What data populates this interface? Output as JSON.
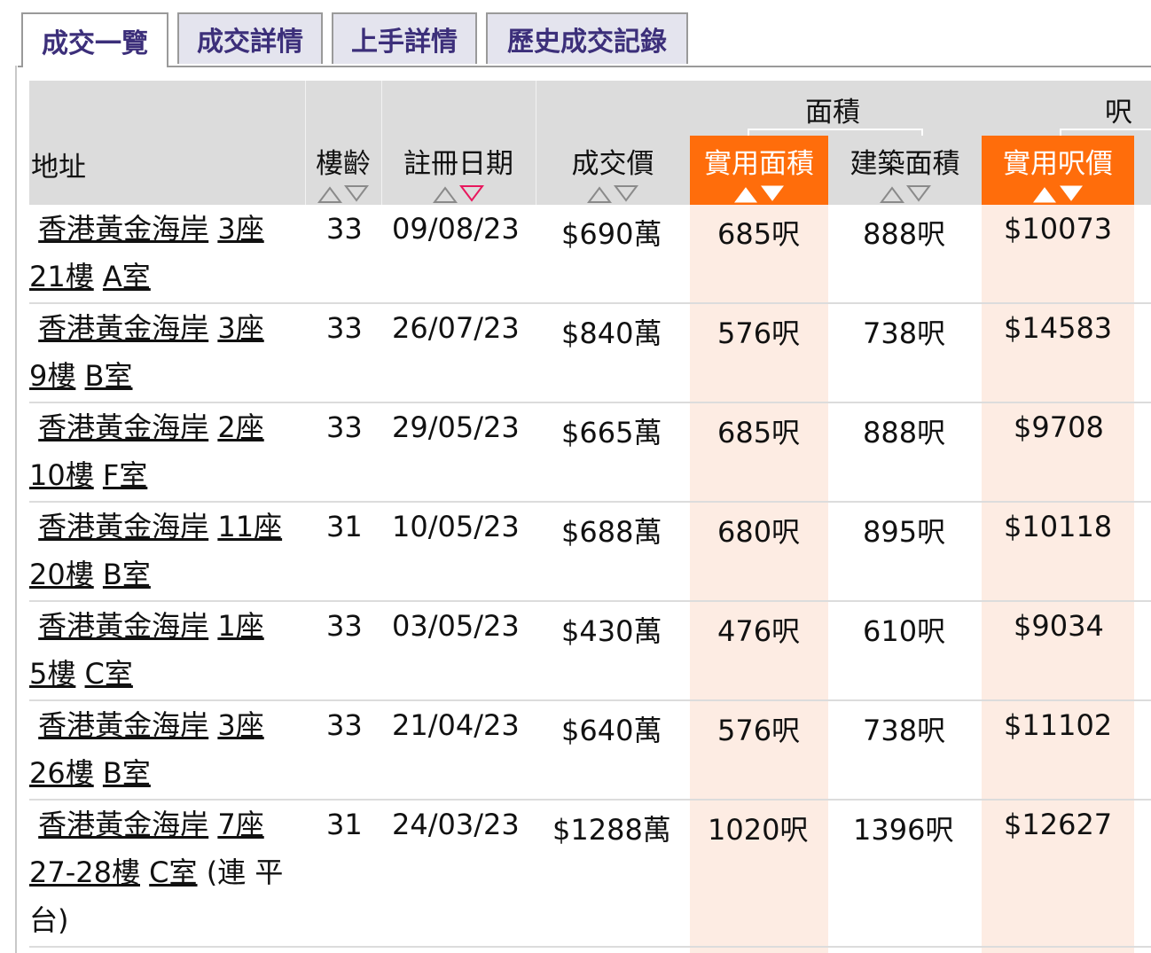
{
  "tabs": [
    {
      "label": "成交一覽",
      "active": true
    },
    {
      "label": "成交詳情",
      "active": false
    },
    {
      "label": "上手詳情",
      "active": false
    },
    {
      "label": "歷史成交記錄",
      "active": false
    }
  ],
  "table": {
    "group_headers": {
      "area": "面積",
      "unit_price": "呎價"
    },
    "headers": {
      "address": "地址",
      "age": "樓齡",
      "reg_date": "註冊日期",
      "price": "成交價",
      "saleable_area": "實用面積",
      "gross_area": "建築面積",
      "saleable_price": "實用呎價"
    },
    "sort": {
      "column": "reg_date",
      "direction": "descending"
    },
    "colors": {
      "highlight": "#ff6d0b",
      "highlight_bg": "#fdece3",
      "header_bg": "#dcdcdc",
      "sort_active": "#e8175d"
    },
    "rows": [
      {
        "estate": "香港黃金海岸",
        "block": "3座",
        "floor": "21樓",
        "unit": "A室",
        "note": "",
        "age": "33",
        "date": "09/08/23",
        "price": "$690萬",
        "saleable": "685呎",
        "gross": "888呎",
        "unit_price": "$10073"
      },
      {
        "estate": "香港黃金海岸",
        "block": "3座",
        "floor": "9樓",
        "unit": "B室",
        "note": "",
        "age": "33",
        "date": "26/07/23",
        "price": "$840萬",
        "saleable": "576呎",
        "gross": "738呎",
        "unit_price": "$14583"
      },
      {
        "estate": "香港黃金海岸",
        "block": "2座",
        "floor": "10樓",
        "unit": "F室",
        "note": "",
        "age": "33",
        "date": "29/05/23",
        "price": "$665萬",
        "saleable": "685呎",
        "gross": "888呎",
        "unit_price": "$9708"
      },
      {
        "estate": "香港黃金海岸",
        "block": "11座",
        "floor": "20樓",
        "unit": "B室",
        "note": "",
        "age": "31",
        "date": "10/05/23",
        "price": "$688萬",
        "saleable": "680呎",
        "gross": "895呎",
        "unit_price": "$10118"
      },
      {
        "estate": "香港黃金海岸",
        "block": "1座",
        "floor": "5樓",
        "unit": "C室",
        "note": "",
        "age": "33",
        "date": "03/05/23",
        "price": "$430萬",
        "saleable": "476呎",
        "gross": "610呎",
        "unit_price": "$9034"
      },
      {
        "estate": "香港黃金海岸",
        "block": "3座",
        "floor": "26樓",
        "unit": "B室",
        "note": "",
        "age": "33",
        "date": "21/04/23",
        "price": "$640萬",
        "saleable": "576呎",
        "gross": "738呎",
        "unit_price": "$11102"
      },
      {
        "estate": "香港黃金海岸",
        "block": "7座",
        "floor": "27-28樓",
        "unit": "C室",
        "note": "(連 平台)",
        "age": "31",
        "date": "24/03/23",
        "price": "$1288萬",
        "saleable": "1020呎",
        "gross": "1396呎",
        "unit_price": "$12627"
      }
    ]
  }
}
